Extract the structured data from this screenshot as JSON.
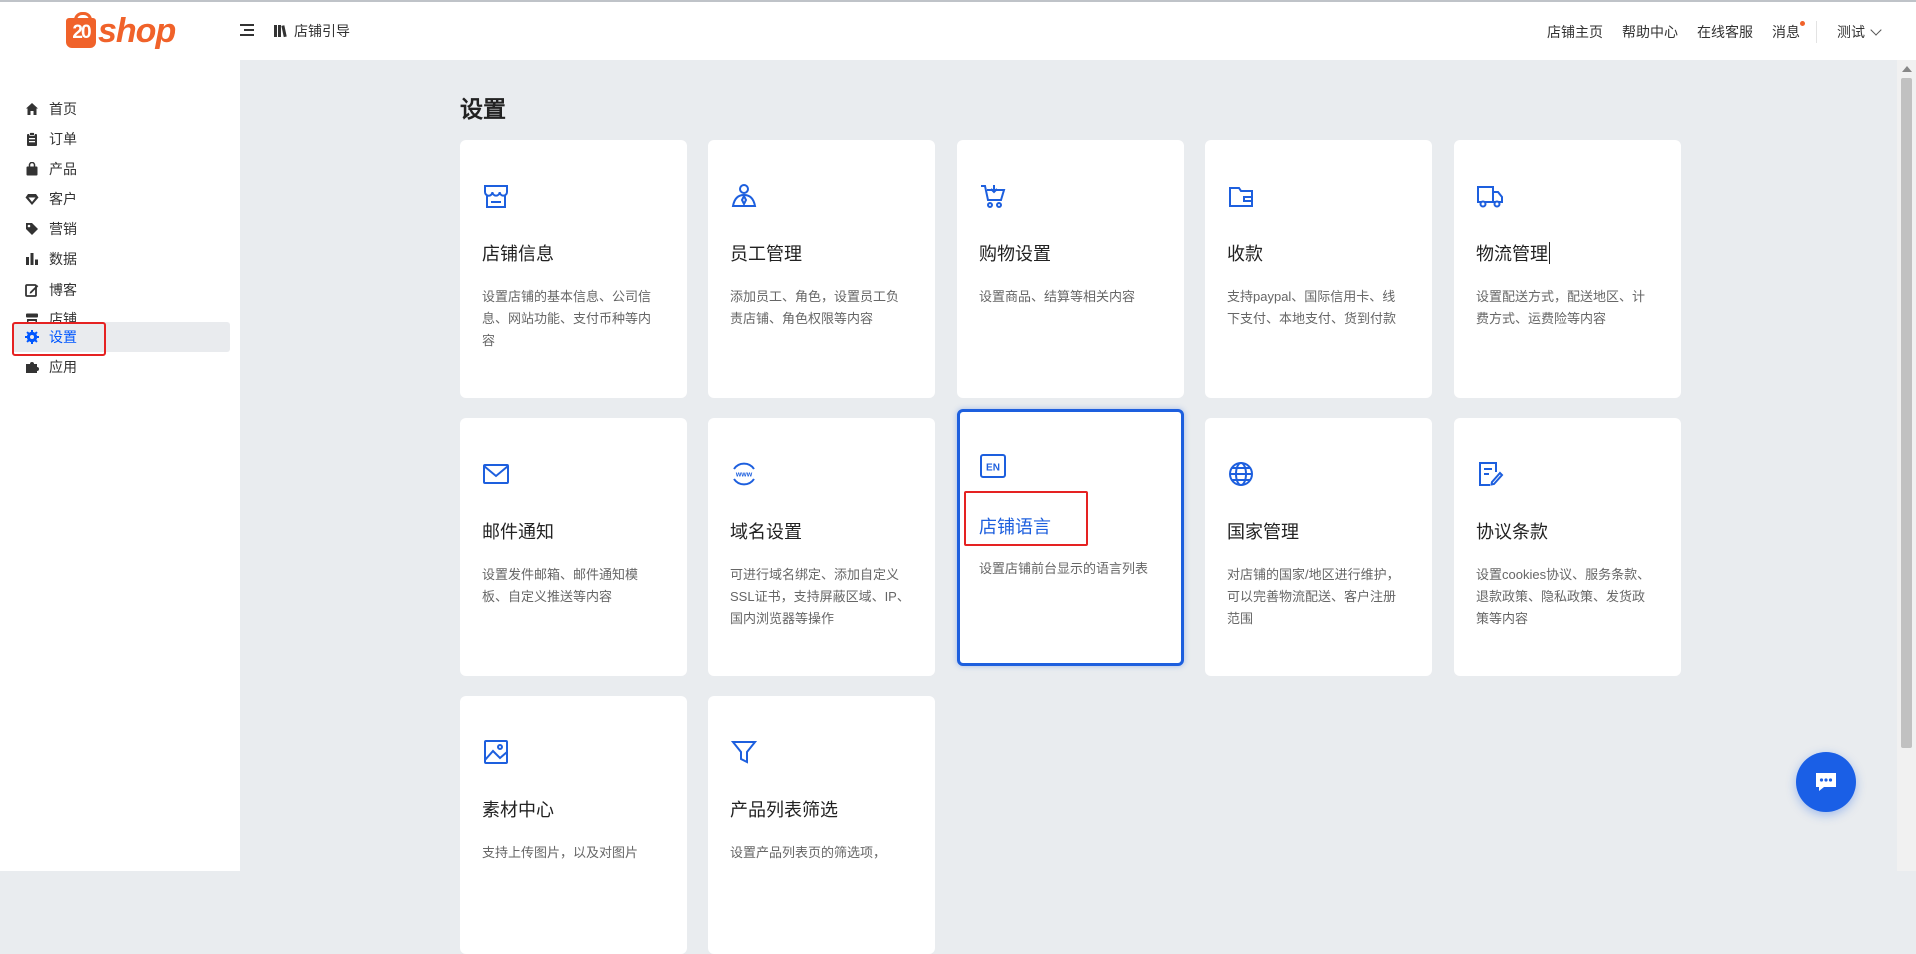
{
  "header": {
    "logo_text": "shop",
    "logo_badge": "20",
    "guide_label": "店铺引导",
    "links": [
      "店铺主页",
      "帮助中心",
      "在线客服",
      "消息"
    ],
    "user_label": "测试"
  },
  "sidebar": {
    "items": [
      {
        "label": "首页",
        "icon": "home-icon"
      },
      {
        "label": "订单",
        "icon": "clipboard-icon"
      },
      {
        "label": "产品",
        "icon": "bag-icon"
      },
      {
        "label": "客户",
        "icon": "diamond-icon"
      },
      {
        "label": "营销",
        "icon": "tag-icon"
      },
      {
        "label": "数据",
        "icon": "bar-chart-icon"
      },
      {
        "label": "博客",
        "icon": "edit-icon"
      },
      {
        "label": "店铺",
        "icon": "store-icon"
      },
      {
        "label": "设置",
        "icon": "gear-icon",
        "active": true
      },
      {
        "label": "应用",
        "icon": "puzzle-icon"
      }
    ]
  },
  "main": {
    "title": "设置",
    "cards": [
      {
        "title": "店铺信息",
        "desc": "设置店铺的基本信息、公司信息、网站功能、支付币种等内容",
        "icon": "store-icon"
      },
      {
        "title": "员工管理",
        "desc": "添加员工、角色，设置员工负责店铺、角色权限等内容",
        "icon": "staff-icon"
      },
      {
        "title": "购物设置",
        "desc": "设置商品、结算等相关内容",
        "icon": "cart-icon"
      },
      {
        "title": "收款",
        "desc": "支持paypal、国际信用卡、线下支付、本地支付、货到付款",
        "icon": "wallet-icon"
      },
      {
        "title": "物流管理",
        "desc": "设置配送方式，配送地区、计费方式、运费险等内容",
        "icon": "truck-icon"
      },
      {
        "title": "邮件通知",
        "desc": "设置发件邮箱、邮件通知模板、自定义推送等内容",
        "icon": "mail-icon"
      },
      {
        "title": "域名设置",
        "desc": "可进行域名绑定、添加自定义SSL证书，支持屏蔽区域、IP、国内浏览器等操作",
        "icon": "www-icon"
      },
      {
        "title": "店铺语言",
        "desc": "设置店铺前台显示的语言列表",
        "icon": "en-icon",
        "selected": true
      },
      {
        "title": "国家管理",
        "desc": "对店铺的国家/地区进行维护，可以完善物流配送、客户注册范围",
        "icon": "globe-icon"
      },
      {
        "title": "协议条款",
        "desc": "设置cookies协议、服务条款、退款政策、隐私政策、发货政策等内容",
        "icon": "document-icon"
      },
      {
        "title": "素材中心",
        "desc": "支持上传图片，以及对图片",
        "icon": "image-icon"
      },
      {
        "title": "产品列表筛选",
        "desc": "设置产品列表页的筛选项，",
        "icon": "filter-icon"
      }
    ]
  },
  "colors": {
    "accent": "#1d5fde",
    "brand": "#f0622a",
    "highlight": "#e52222",
    "background": "#e9ecef"
  }
}
